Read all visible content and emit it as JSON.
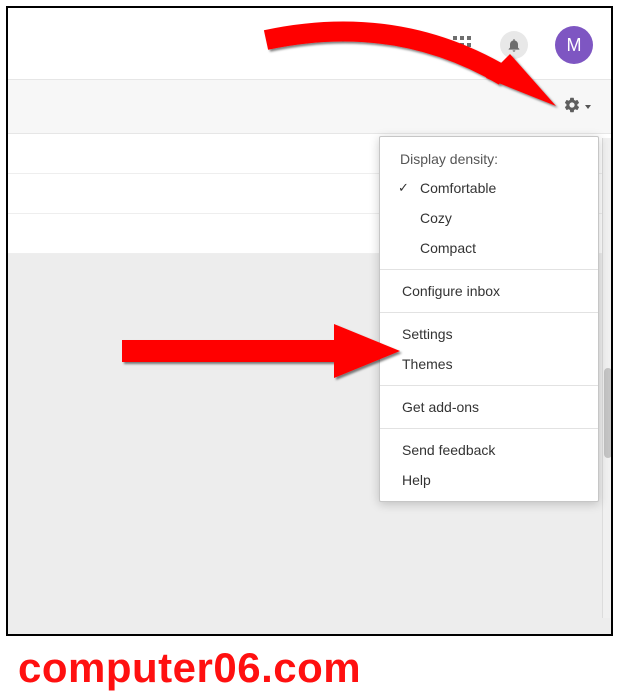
{
  "topbar": {
    "avatar_initial": "M"
  },
  "menu": {
    "header": "Display density:",
    "density": {
      "comfortable": "Comfortable",
      "cozy": "Cozy",
      "compact": "Compact"
    },
    "configure_inbox": "Configure inbox",
    "settings": "Settings",
    "themes": "Themes",
    "get_addons": "Get add-ons",
    "send_feedback": "Send feedback",
    "help": "Help"
  },
  "watermark": "computer06.com"
}
